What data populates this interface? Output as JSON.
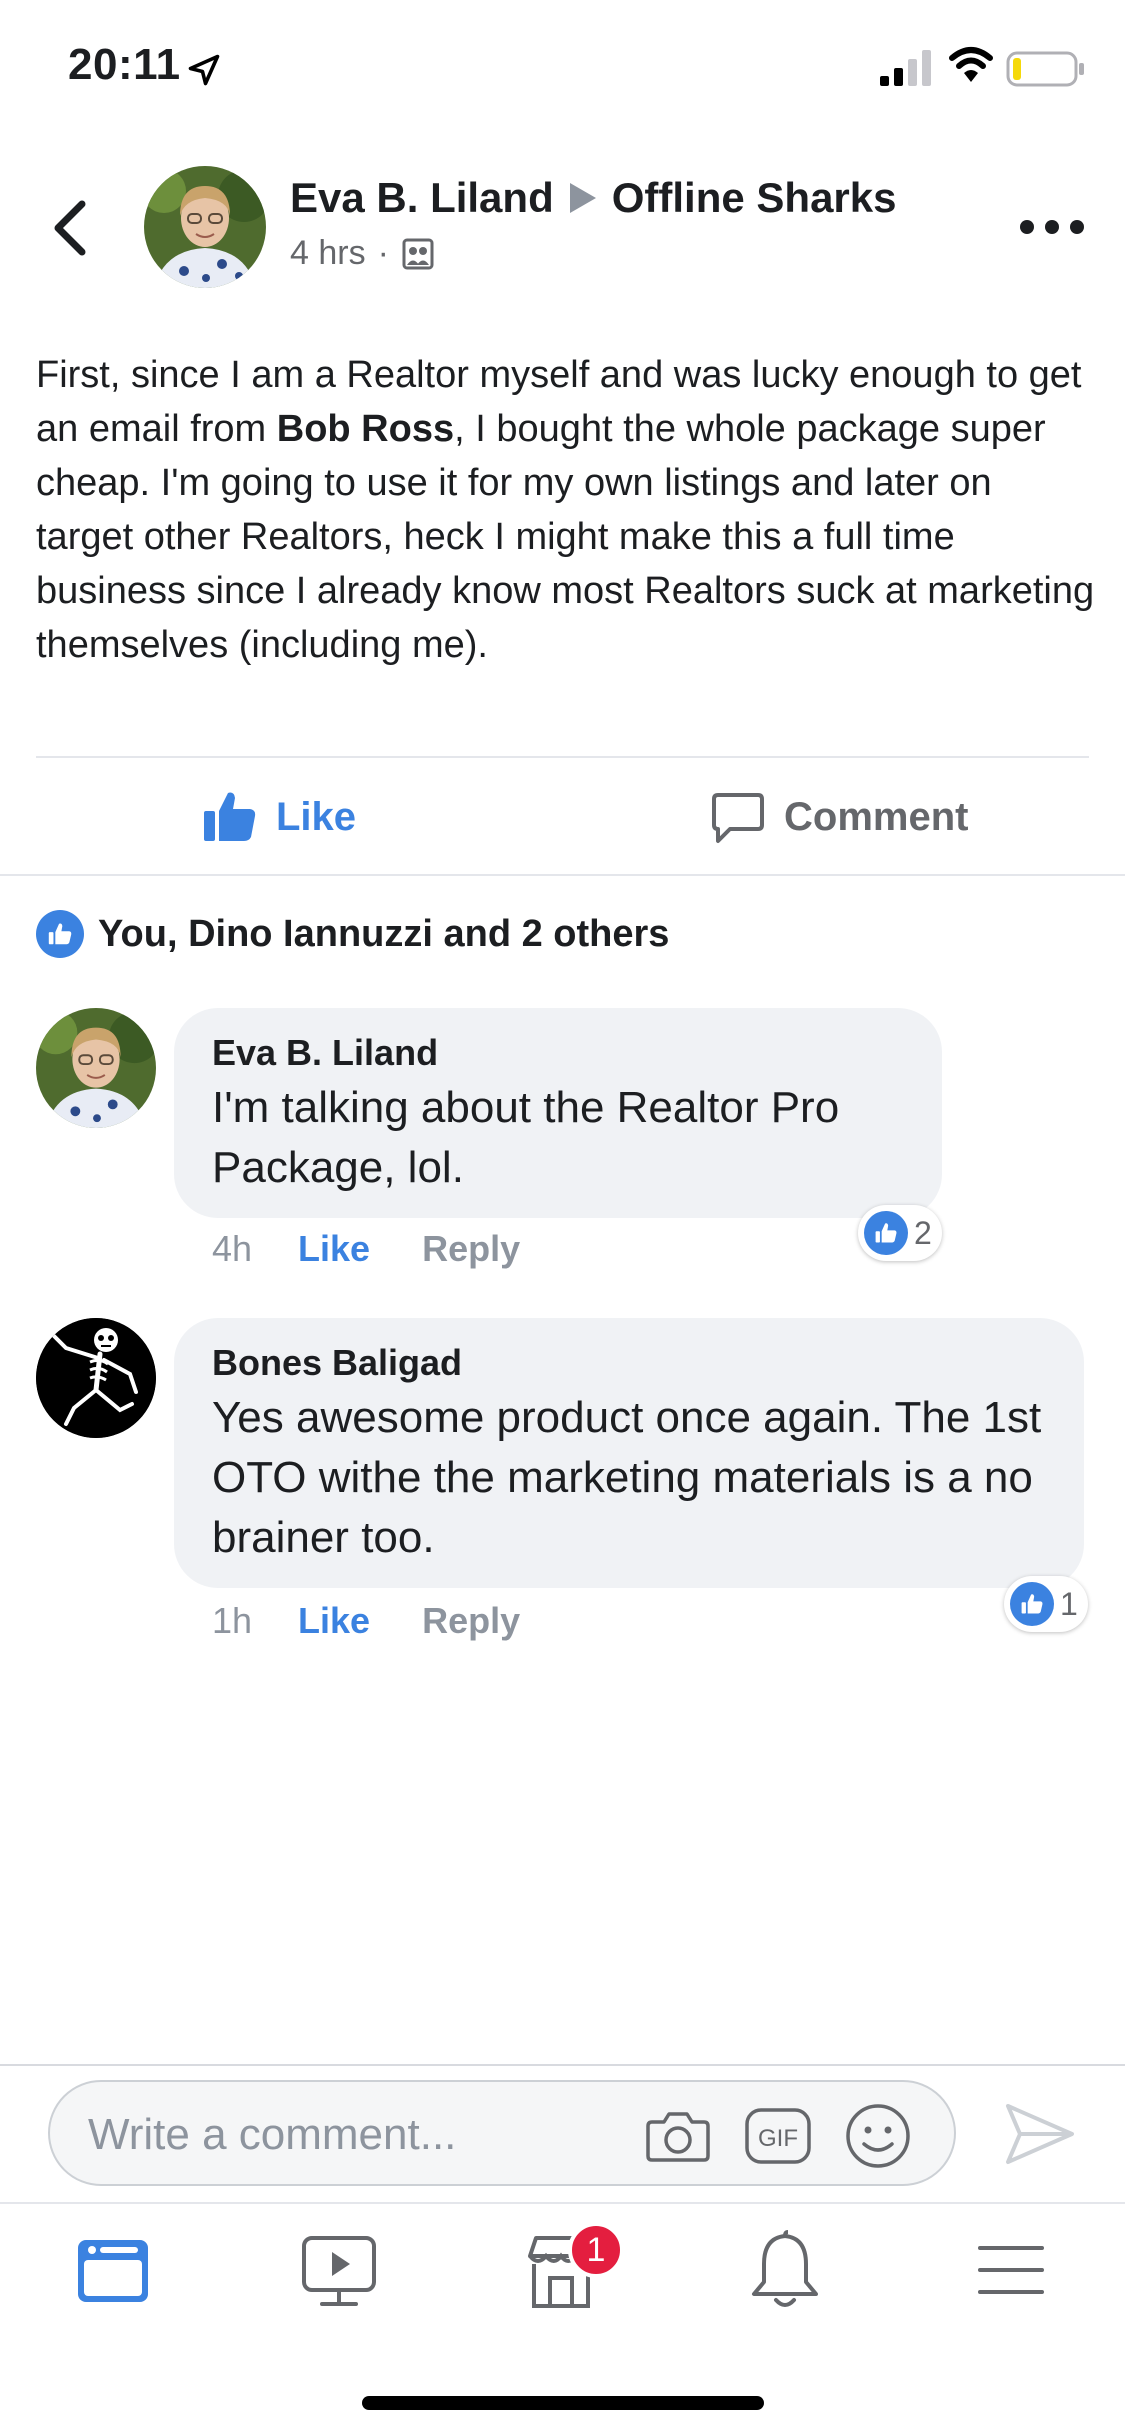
{
  "status_bar": {
    "time": "20:11",
    "icons": [
      "location-arrow-icon",
      "cellular-signal-icon",
      "wifi-icon",
      "battery-icon"
    ]
  },
  "post": {
    "author": "Eva B. Liland",
    "group": "Offline Sharks",
    "time": "4 hrs",
    "separator": "·",
    "text_before_bold": "First, since I am a Realtor myself and was lucky enough to get an email from ",
    "text_bold": "Bob Ross",
    "text_after_bold": ", I bought the whole package super cheap. I'm going to use it for my own listings and later on target other Realtors, heck I might make this a full time business since I already know most Realtors suck at marketing themselves (including me).",
    "like_label": "Like",
    "comment_label": "Comment",
    "reactions_summary": "You, Dino Iannuzzi and 2 others"
  },
  "comments": [
    {
      "name": "Eva B. Liland",
      "text": "I'm talking about the Realtor Pro Package, lol.",
      "time": "4h",
      "like_label": "Like",
      "reply_label": "Reply",
      "reaction_count": "2"
    },
    {
      "name": "Bones Baligad",
      "text": "Yes awesome product once again. The 1st OTO withe the marketing materials is a no brainer too.",
      "time": "1h",
      "like_label": "Like",
      "reply_label": "Reply",
      "reaction_count": "1"
    }
  ],
  "composer": {
    "placeholder": "Write a comment...",
    "gif_label": "GIF"
  },
  "tab_bar": {
    "tabs": [
      "news-feed",
      "watch",
      "marketplace",
      "notifications",
      "menu"
    ],
    "marketplace_badge": "1"
  },
  "colors": {
    "accent": "#3b82e0",
    "badge": "#e41e3f",
    "bubble": "#f0f2f5",
    "muted_text": "#8d949e"
  }
}
